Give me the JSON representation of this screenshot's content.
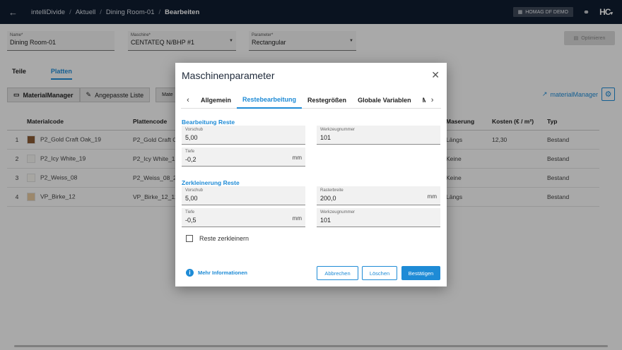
{
  "topbar": {
    "back_icon": "arrow-left-icon",
    "breadcrumb": [
      "intelliDivide",
      "Aktuell",
      "Dining Room-01",
      "Bearbeiten"
    ],
    "demo_badge": "HOMAG DF DEMO",
    "logo": "HC"
  },
  "form": {
    "name": {
      "label": "Name*",
      "value": "Dining Room-01"
    },
    "machine": {
      "label": "Maschine*",
      "value": "CENTATEQ N/BHP #1"
    },
    "parameter": {
      "label": "Parameter*",
      "value": "Rectangular"
    },
    "optimize_label": "Optimieren"
  },
  "main_tabs": [
    "Teile",
    "Platten"
  ],
  "toolbar": {
    "material_manager": "MaterialManager",
    "custom_list": "Angepasste Liste",
    "extra": "Mate",
    "mm_link": "materialManager"
  },
  "table": {
    "headers": [
      "Materialcode",
      "Plattencode",
      "Maserung",
      "Kosten (€ / m²)",
      "Typ"
    ],
    "rows": [
      {
        "num": "1",
        "material": "P2_Gold Craft Oak_19",
        "platte": "P2_Gold Craft O",
        "maserung": "Längs",
        "kosten": "12,30",
        "typ": "Bestand",
        "color": "#8a5a34"
      },
      {
        "num": "2",
        "material": "P2_Icy White_19",
        "platte": "P2_Icy White_1",
        "maserung": "Keine",
        "kosten": "",
        "typ": "Bestand",
        "color": "#f3f3f1"
      },
      {
        "num": "3",
        "material": "P2_Weiss_08",
        "platte": "P2_Weiss_08_2",
        "maserung": "Keine",
        "kosten": "",
        "typ": "Bestand",
        "color": "#f7f5ef"
      },
      {
        "num": "4",
        "material": "VP_Birke_12",
        "platte": "VP_Birke_12_12",
        "maserung": "Längs",
        "kosten": "",
        "typ": "Bestand",
        "color": "#e6c9a0"
      }
    ]
  },
  "dialog": {
    "title": "Maschinenparameter",
    "tabs": [
      "Allgemein",
      "Restebearbeitung",
      "Restegrößen",
      "Globale Variablen",
      "M"
    ],
    "active_tab": "Restebearbeitung",
    "section1": {
      "title": "Bearbeitung Reste",
      "vorschub": {
        "label": "Vorschub",
        "value": "5,00"
      },
      "werkzeug": {
        "label": "Werkzeugnummer",
        "value": "101"
      },
      "tiefe": {
        "label": "Tiefe",
        "value": "-0,2",
        "unit": "mm"
      }
    },
    "section2": {
      "title": "Zerkleinerung Reste",
      "vorschub": {
        "label": "Vorschub",
        "value": "5,00"
      },
      "raster": {
        "label": "Rasterbreite",
        "value": "200,0",
        "unit": "mm"
      },
      "tiefe": {
        "label": "Tiefe",
        "value": "-0,5",
        "unit": "mm"
      },
      "werkzeug": {
        "label": "Werkzeugnummer",
        "value": "101"
      }
    },
    "checkbox_label": "Reste zerkleinern",
    "more_info": "Mehr Informationen",
    "cancel": "Abbrechen",
    "delete": "Löschen",
    "confirm": "Bestätigen"
  },
  "colors": {
    "accent": "#1e8bd6",
    "topbar": "#0f1c30"
  }
}
